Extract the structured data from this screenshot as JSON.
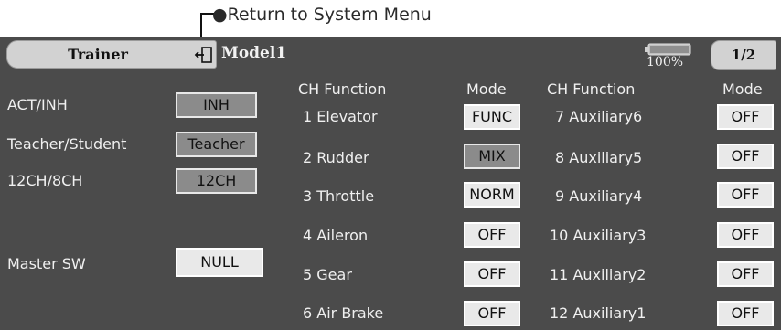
{
  "annotation": {
    "text": "●Return to System Menu"
  },
  "topbar": {
    "title": "Trainer",
    "return_icon": "return-door-icon",
    "model_name": "Model1",
    "battery_percent": "100%",
    "battery_level": 1.0,
    "page": "1/2"
  },
  "left": {
    "act_inh": {
      "label": "ACT/INH",
      "value": "INH"
    },
    "teacher_student": {
      "label": "Teacher/Student",
      "value": "Teacher"
    },
    "ch_mode": {
      "label": "12CH/8CH",
      "value": "12CH"
    },
    "master_sw": {
      "label": "Master SW",
      "value": "NULL"
    }
  },
  "columns": {
    "left": {
      "ch_function": "CH Function",
      "mode": "Mode"
    },
    "right": {
      "ch_function": "CH Function",
      "mode": "Mode"
    }
  },
  "channels_left": [
    {
      "label": "1 Elevator",
      "mode": "FUNC",
      "style": "light"
    },
    {
      "label": "2 Rudder",
      "mode": "MIX",
      "style": "dark"
    },
    {
      "label": "3 Throttle",
      "mode": "NORM",
      "style": "light"
    },
    {
      "label": "4 Aileron",
      "mode": "OFF",
      "style": "light"
    },
    {
      "label": "5 Gear",
      "mode": "OFF",
      "style": "light"
    },
    {
      "label": "6 Air Brake",
      "mode": "OFF",
      "style": "light"
    }
  ],
  "channels_right": [
    {
      "label": "7 Auxiliary6",
      "mode": "OFF",
      "style": "light"
    },
    {
      "label": "8 Auxiliary5",
      "mode": "OFF",
      "style": "light"
    },
    {
      "label": "9 Auxiliary4",
      "mode": "OFF",
      "style": "light"
    },
    {
      "label": "10 Auxiliary3",
      "mode": "OFF",
      "style": "light"
    },
    {
      "label": "11 Auxiliary2",
      "mode": "OFF",
      "style": "light"
    },
    {
      "label": "12 Auxiliary1",
      "mode": "OFF",
      "style": "light"
    }
  ]
}
